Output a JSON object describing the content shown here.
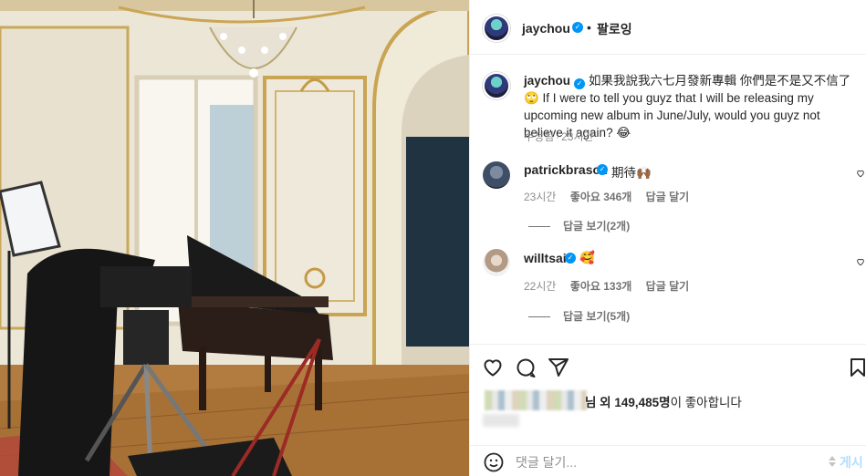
{
  "header": {
    "username": "jaychou",
    "separator": "•",
    "follow_label": "팔로잉"
  },
  "caption": {
    "username": "jaychou",
    "text": "如果我說我六七月發新專輯 你們是不是又不信了🙄 If I were to tell you guyz that I will be releasing my upcoming new album in June/July, would you guyz not believe it again? 😂",
    "edited": "수정됨",
    "separator": "·",
    "time": "23시간"
  },
  "comments": [
    {
      "username": "patrickbrasca",
      "text": "期待🙌🏾",
      "time": "23시간",
      "likes": "좋아요 346개",
      "reply_label": "답글 달기",
      "view_replies": "답글 보기(2개)"
    },
    {
      "username": "willtsai",
      "text": "🥰",
      "time": "22시간",
      "likes": "좋아요 133개",
      "reply_label": "답글 달기",
      "view_replies": "답글 보기(5개)"
    }
  ],
  "likes_summary": {
    "prefix": "님 외 149,485명",
    "suffix": "이 좋아합니다"
  },
  "add_comment": {
    "placeholder": "댓글 달기...",
    "post_label": "게시"
  },
  "icons": {
    "like": "heart-icon",
    "comment": "comment-icon",
    "share": "share-icon",
    "save": "bookmark-icon",
    "emoji": "emoji-icon"
  },
  "colors": {
    "verified": "#0095f6",
    "text": "#262626",
    "muted": "#8e8e8e",
    "post_disabled": "#b2dffc"
  }
}
